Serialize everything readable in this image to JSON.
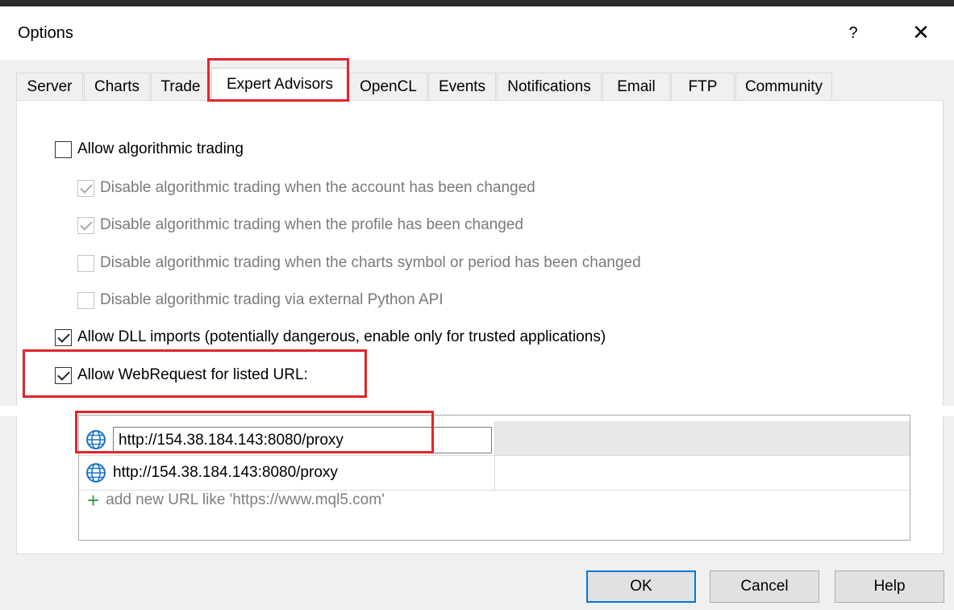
{
  "window": {
    "title": "Options",
    "help_glyph": "?",
    "close_glyph": "✕"
  },
  "tabs": [
    {
      "label": "Server"
    },
    {
      "label": "Charts"
    },
    {
      "label": "Trade"
    },
    {
      "label": "Expert Advisors",
      "active": true
    },
    {
      "label": "OpenCL"
    },
    {
      "label": "Events"
    },
    {
      "label": "Notifications"
    },
    {
      "label": "Email"
    },
    {
      "label": "FTP"
    },
    {
      "label": "Community"
    }
  ],
  "options": {
    "allow_algo": {
      "label": "Allow algorithmic trading",
      "checked": false,
      "enabled": true
    },
    "disable_account": {
      "label": "Disable algorithmic trading when the account has been changed",
      "checked": true,
      "enabled": false
    },
    "disable_profile": {
      "label": "Disable algorithmic trading when the profile has been changed",
      "checked": true,
      "enabled": false
    },
    "disable_symbol": {
      "label": "Disable algorithmic trading when the charts symbol or period has been changed",
      "checked": false,
      "enabled": false
    },
    "disable_python": {
      "label": "Disable algorithmic trading via external Python API",
      "checked": false,
      "enabled": false
    },
    "allow_dll": {
      "label": "Allow DLL imports (potentially dangerous, enable only for trusted applications)",
      "checked": true,
      "enabled": true
    },
    "allow_webrequest": {
      "label": "Allow WebRequest for listed URL:",
      "checked": true,
      "enabled": true
    }
  },
  "url_list": {
    "editing_value": "http://154.38.184.143:8080/proxy",
    "items": [
      "http://154.38.184.143:8080/proxy"
    ],
    "add_placeholder": "add new URL like 'https://www.mql5.com'",
    "add_icon": "plus-icon"
  },
  "buttons": {
    "ok": "OK",
    "cancel": "Cancel",
    "help": "Help"
  },
  "colors": {
    "highlight": "#e0262b",
    "add_icon": "#2ea043",
    "globe": "#1e74c6",
    "default_button_border": "#0078d7"
  }
}
